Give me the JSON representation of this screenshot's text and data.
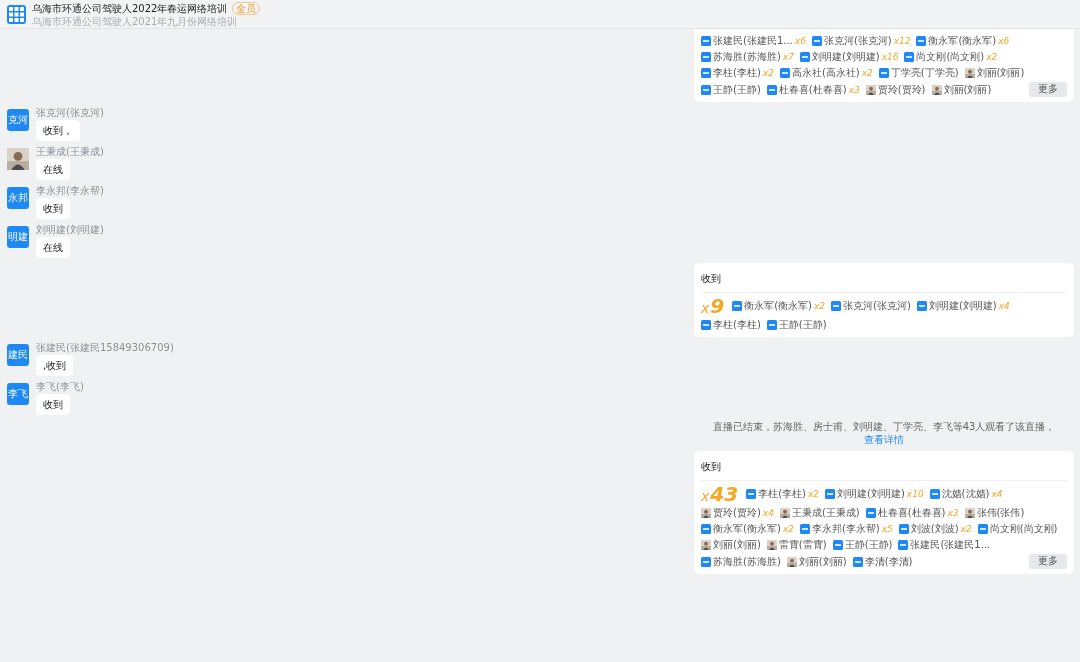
{
  "header": {
    "title": "乌海市环通公司驾驶人2022年春运网络培训",
    "badge": "全员",
    "subtitle": "乌海市环通公司驾驶人2021年九月份网络培训"
  },
  "messages": [
    {
      "kind": "reactions",
      "reactions": [
        {
          "kind": "tag",
          "name": "张建民(张建民1...",
          "count": "x6"
        },
        {
          "kind": "tag",
          "name": "张克河(张克河)",
          "count": "x12"
        },
        {
          "kind": "tag",
          "name": "衡永军(衡永军)",
          "count": "x6"
        },
        {
          "kind": "tag",
          "name": "苏海胜(苏海胜)",
          "count": "x7"
        },
        {
          "kind": "tag",
          "name": "刘明建(刘明建)",
          "count": "x16"
        },
        {
          "kind": "tag",
          "name": "尚文刚(尚文刚)",
          "count": "x2"
        },
        {
          "kind": "tag",
          "name": "李柱(李柱)",
          "count": "x2"
        },
        {
          "kind": "tag",
          "name": "高永社(高永社)",
          "count": "x2"
        },
        {
          "kind": "tag",
          "name": "丁学亮(丁学亮)"
        },
        {
          "name": "刘丽(刘丽)"
        },
        {
          "kind": "tag",
          "name": "王静(王静)"
        },
        {
          "kind": "tag",
          "name": "杜春喜(杜春喜)",
          "count": "x3"
        },
        {
          "name": "贾玲(贾玲)"
        },
        {
          "name": "刘丽(刘丽)"
        }
      ],
      "more": "更多"
    },
    {
      "kind": "chat",
      "avatar": {
        "kind": "text",
        "text": "克河"
      },
      "sender": "张克河(张克河)",
      "text": "收到，"
    },
    {
      "kind": "chat",
      "sender": "王秉成(王秉成)",
      "text": "在线"
    },
    {
      "kind": "chat",
      "avatar": {
        "kind": "text",
        "text": "永邦"
      },
      "sender": "李永邦(李永帮)",
      "text": "收到"
    },
    {
      "kind": "chat",
      "avatar": {
        "kind": "text",
        "text": "明建"
      },
      "sender": "刘明建(刘明建)",
      "text": "在线"
    },
    {
      "kind": "reactions",
      "title": "收到",
      "total_mark": "x",
      "total": "9",
      "reactions": [
        {
          "kind": "tag",
          "name": "衡永军(衡永军)",
          "count": "x2"
        },
        {
          "kind": "tag",
          "name": "张克河(张克河)"
        },
        {
          "kind": "tag",
          "name": "刘明建(刘明建)",
          "count": "x4"
        },
        {
          "kind": "tag",
          "name": "李柱(李柱)"
        },
        {
          "kind": "tag",
          "name": "王静(王静)"
        }
      ]
    },
    {
      "kind": "chat",
      "avatar": {
        "kind": "text",
        "text": "建民"
      },
      "sender": "张建民(张建民15849306709)",
      "text": ",收到"
    },
    {
      "kind": "chat",
      "avatar": {
        "kind": "text",
        "text": "李飞"
      },
      "sender": "李飞(李飞)",
      "text": "收到"
    },
    {
      "kind": "notice",
      "text": "直播已结束，苏海胜、房士甫、刘明建、丁学亮、李飞等43人观看了该直播，",
      "link": "查看详情"
    },
    {
      "kind": "reactions",
      "title": "收到",
      "total_mark": "x",
      "total": "43",
      "reactions": [
        {
          "kind": "tag",
          "name": "李柱(李柱)",
          "count": "x2"
        },
        {
          "kind": "tag",
          "name": "刘明建(刘明建)",
          "count": "x10"
        },
        {
          "kind": "tag",
          "name": "沈嫱(沈嫱)",
          "count": "x4"
        },
        {
          "name": "贾玲(贾玲)",
          "count": "x4"
        },
        {
          "name": "王秉成(王秉成)"
        },
        {
          "kind": "tag",
          "name": "杜春喜(杜春喜)",
          "count": "x3"
        },
        {
          "name": "张伟(张伟)"
        },
        {
          "kind": "tag",
          "name": "衡永军(衡永军)",
          "count": "x2"
        },
        {
          "kind": "tag",
          "name": "李永邦(李永帮)",
          "count": "x5"
        },
        {
          "kind": "tag",
          "name": "刘波(刘波)",
          "count": "x2"
        },
        {
          "kind": "tag",
          "name": "尚文刚(尚文刚)"
        },
        {
          "name": "刘丽(刘丽)"
        },
        {
          "name": "雷霄(雷霄)"
        },
        {
          "kind": "tag",
          "name": "王静(王静)"
        },
        {
          "kind": "tag",
          "name": "张建民(张建民1..."
        },
        {
          "kind": "tag",
          "name": "苏海胜(苏海胜)"
        },
        {
          "name": "刘丽(刘丽)"
        },
        {
          "kind": "tag",
          "name": "李清(李清)"
        }
      ],
      "more": "更多"
    }
  ]
}
